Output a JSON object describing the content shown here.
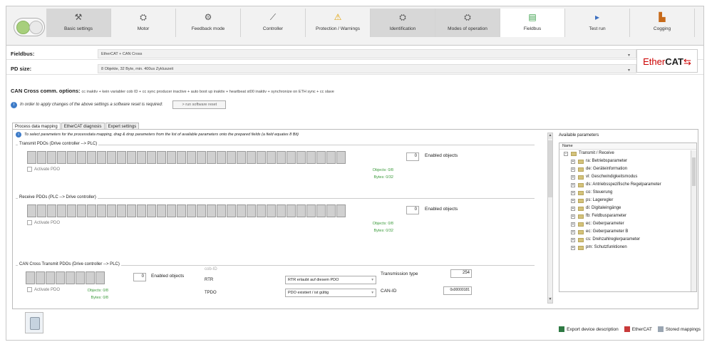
{
  "toolbar": {
    "tabs": [
      {
        "label": "Basic settings",
        "icon": "wrench-icon",
        "glyph": "⚒"
      },
      {
        "label": "Motor",
        "icon": "motor-icon",
        "glyph": "⛭"
      },
      {
        "label": "Feedback mode",
        "icon": "feedback-icon",
        "glyph": "⚙"
      },
      {
        "label": "Controller",
        "icon": "controller-icon",
        "glyph": "⟋"
      },
      {
        "label": "Protection / Warnings",
        "icon": "warning-icon",
        "glyph": "⚠"
      },
      {
        "label": "Identification",
        "icon": "identification-icon",
        "glyph": "⛭"
      },
      {
        "label": "Modes of operation",
        "icon": "modes-icon",
        "glyph": "⛭"
      },
      {
        "label": "Fieldbus",
        "icon": "fieldbus-icon",
        "glyph": "▤"
      },
      {
        "label": "Test run",
        "icon": "play-icon",
        "glyph": "▸"
      },
      {
        "label": "Cogging",
        "icon": "cogging-icon",
        "glyph": "▙"
      }
    ]
  },
  "fieldbus": {
    "label": "Fieldbus:",
    "value": "EtherCAT + CAN Cross"
  },
  "pdsize": {
    "label": "PD size:",
    "value": "8 Objekte, 32 Byte, min. 400us Zykluszeit"
  },
  "ethercat_logo": {
    "ether": "Ether",
    "cat": "CAT"
  },
  "can_options": {
    "label": "CAN Cross comm. options:",
    "text": "cc inaktiv + kein variabler cob ID + cc sync producer inactive + auto boot up inaktiv + heartbeat st00 inaktiv + synchronize on ETH sync + cc slave"
  },
  "apply_info": {
    "text": "In order to apply changes of the above settings a software reset is required:",
    "button": "> run software reset"
  },
  "subtabs": [
    "Process data mapping",
    "EtherCAT diagnosis",
    "Expert settings"
  ],
  "mapping": {
    "hint": "To select parameters for the processdata mapping, drag & drop parameters from the list of available parameters onto the prepared fields (a field equates 8 Bit)",
    "transmit": {
      "title": "Transmit PDOs (Drive controller --> PLC)",
      "count": "0",
      "enabled": "Enabled objects",
      "activate": "Activate PDO",
      "objects": "Objects: 0/8",
      "bytes": "Bytes: 0/32"
    },
    "receive": {
      "title": "Receive PDOs (PLC --> Drive controller)",
      "count": "0",
      "enabled": "Enabled objects",
      "activate": "Activate PDO",
      "objects": "Objects: 0/8",
      "bytes": "Bytes: 0/32"
    },
    "can": {
      "title": "CAN Cross Transmit PDOs (Drive controller --> PLC)",
      "count": "0",
      "enabled": "Enabled objects",
      "activate": "Activate PDO",
      "objects": "Objects: 0/8",
      "bytes": "Bytes: 0/8",
      "cob_id": "cob-ID",
      "rtr_label": "RTR",
      "rtr_value": "RTR erlaubt auf diesem PDO",
      "tpdo_label": "TPDO",
      "tpdo_value": "PDO existiert / ist gültig",
      "trans_label": "Transmission type",
      "trans_value": "254",
      "canid_label": "CAN-ID",
      "canid_value": "0x00000181"
    }
  },
  "available": {
    "title": "Available parameters",
    "header": "Name",
    "root": "Transmit / Receive",
    "items": [
      "ra: Betriebsparameter",
      "de: Geräteinformation",
      "vl: Geschwindigkeitsmodus",
      "ds: Antriebsspezifische Regelparameter",
      "co: Steuerung",
      "ps: Lageregler",
      "di: Digitaleingänge",
      "fb: Feldbusparameter",
      "ec: Geberparameter",
      "ec: Geberparameter B",
      "cs: Drehzahlreglerparameter",
      "pm: Schutzfunktionen"
    ]
  },
  "links": {
    "export": "Export device description",
    "ethercat": "EtherCAT",
    "stored": "Stored mappings"
  }
}
